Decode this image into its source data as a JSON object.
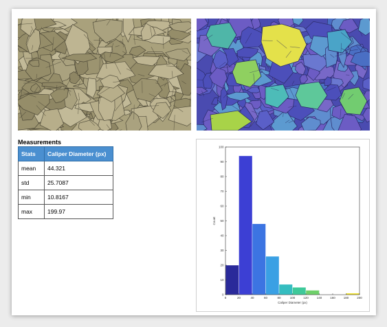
{
  "measurements": {
    "title": "Measurements",
    "headers": [
      "Stats",
      "Caliper Diameter (px)"
    ],
    "rows": [
      {
        "stat": "mean",
        "value": "44.321"
      },
      {
        "stat": "std",
        "value": "25.7087"
      },
      {
        "stat": "min",
        "value": "10.8167"
      },
      {
        "stat": "max",
        "value": "199.97"
      }
    ]
  },
  "images": {
    "left": "microstructure-grain-image",
    "right": "segmented-grain-image"
  },
  "chart_data": {
    "type": "bar",
    "title": "",
    "xlabel": "Caliper Diameter (px)",
    "ylabel": "Count",
    "xlim": [
      0,
      200
    ],
    "ylim": [
      0,
      100
    ],
    "xticks": [
      0,
      20,
      40,
      60,
      80,
      100,
      120,
      140,
      160,
      180,
      200
    ],
    "yticks": [
      0,
      10,
      20,
      30,
      40,
      50,
      60,
      70,
      80,
      90,
      100
    ],
    "bins": [
      {
        "x0": 0,
        "x1": 20,
        "count": 20,
        "color": "#2a2a9a"
      },
      {
        "x0": 20,
        "x1": 40,
        "count": 94,
        "color": "#3c3fd4"
      },
      {
        "x0": 40,
        "x1": 60,
        "count": 48,
        "color": "#3c74e2"
      },
      {
        "x0": 60,
        "x1": 80,
        "count": 26,
        "color": "#3aa0e4"
      },
      {
        "x0": 80,
        "x1": 100,
        "count": 7,
        "color": "#35bdc0"
      },
      {
        "x0": 100,
        "x1": 120,
        "count": 5,
        "color": "#3ec99a"
      },
      {
        "x0": 120,
        "x1": 140,
        "count": 3,
        "color": "#6fd06a"
      },
      {
        "x0": 140,
        "x1": 160,
        "count": 0,
        "color": "#a8d040"
      },
      {
        "x0": 160,
        "x1": 180,
        "count": 0,
        "color": "#d4cc2e"
      },
      {
        "x0": 180,
        "x1": 200,
        "count": 1,
        "color": "#f0e020"
      }
    ],
    "grid": false,
    "legend": "none"
  }
}
